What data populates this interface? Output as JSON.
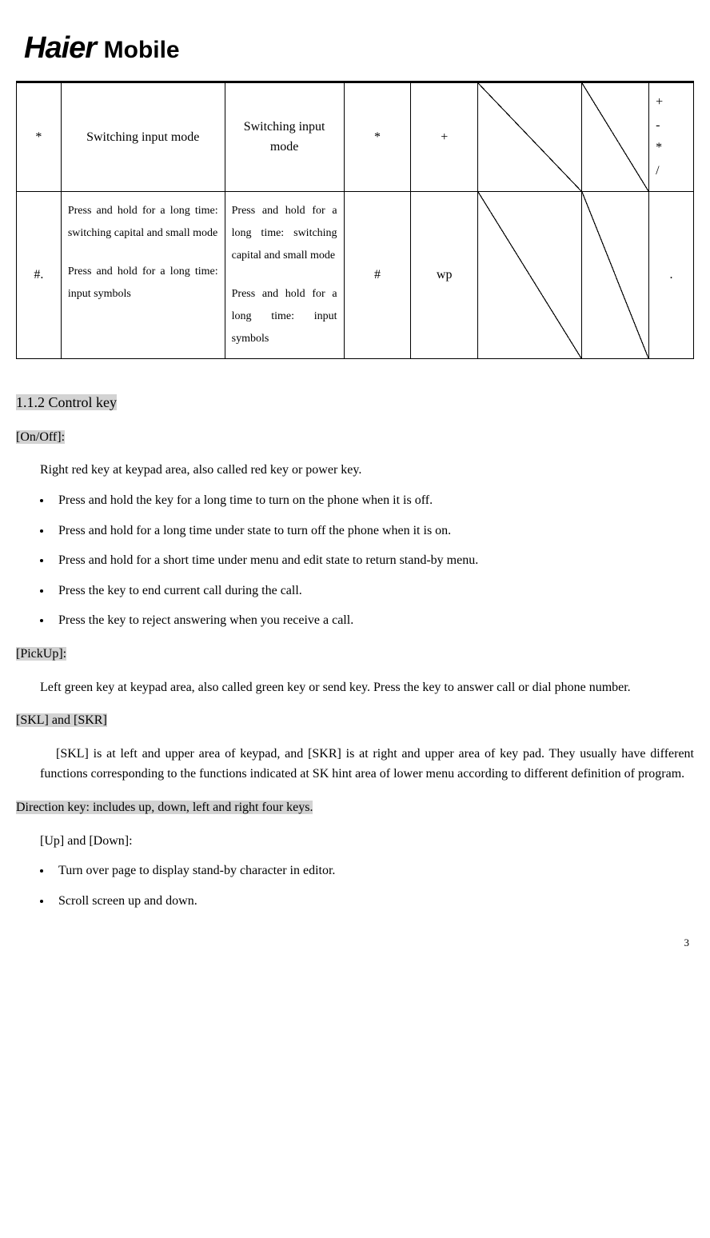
{
  "logo": {
    "brand": "Haier",
    "suffix": "Mobile"
  },
  "table": {
    "row1": {
      "c1": "*",
      "c2": "Switching input mode",
      "c3": "Switching input mode",
      "c4": "*",
      "c5": "+",
      "c8": "+\n-\n*\n/"
    },
    "row2": {
      "c1": "#.",
      "c2a": "Press and hold for a long time: switching capital and small mode",
      "c2b": "Press and hold for a long time: input symbols",
      "c3a": "Press and hold for a long time: switching capital and small mode",
      "c3b": "Press and hold for a long time: input symbols",
      "c4": "#",
      "c5": "wp",
      "c8": "."
    }
  },
  "section": {
    "title": "1.1.2 Control key",
    "onoff": {
      "heading": "[On/Off]:",
      "intro": "Right red key at keypad area, also called red key or power key.",
      "items": [
        "Press and hold the key for a long time to turn on the phone when it is off.",
        "Press and hold for a long time under state to turn off the phone when it is on.",
        "Press and hold for a short time under menu and edit state to return stand-by menu.",
        "Press the key to end current call during the call.",
        "Press the key to reject answering when you receive a call."
      ]
    },
    "pickup": {
      "heading": "[PickUp]:",
      "text": "Left green key at keypad area, also called green key or send key. Press the key to answer call or dial phone number."
    },
    "skl": {
      "heading": "[SKL] and [SKR]",
      "text": "[SKL] is at left and upper area of keypad, and [SKR] is at right and upper area of key pad. They usually have different functions corresponding to the functions indicated at SK hint area of lower menu according to different definition of program."
    },
    "direction": {
      "heading": "Direction key: includes up, down, left and right four keys.",
      "updown": {
        "heading": "[Up] and [Down]:",
        "items": [
          "Turn over page to display stand-by character in editor.",
          "Scroll screen up and down."
        ]
      }
    }
  },
  "page_number": "3"
}
